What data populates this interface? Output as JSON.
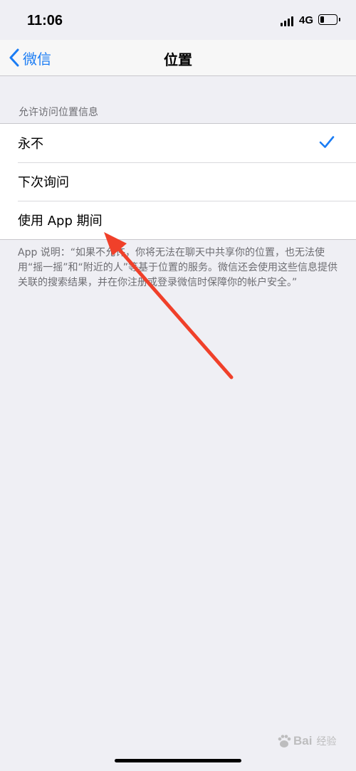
{
  "status_bar": {
    "time": "11:06",
    "network": "4G",
    "battery_level": 0.25
  },
  "nav": {
    "back_label": "微信",
    "title": "位置"
  },
  "section_header": "允许访问位置信息",
  "options": [
    {
      "label": "永不",
      "selected": true
    },
    {
      "label": "下次询问",
      "selected": false
    },
    {
      "label": "使用 App 期间",
      "selected": false
    }
  ],
  "footer_text": "App 说明：“如果不允许，你将无法在聊天中共享你的位置，也无法使用“摇一摇”和“附近的人”等基于位置的服务。微信还会使用这些信息提供关联的搜索结果，并在你注册或登录微信时保障你的帐户安全。”",
  "watermark": {
    "text": "Bai",
    "subtext": "经验"
  },
  "colors": {
    "accent": "#1a7cf4",
    "arrow": "#f0402a",
    "background": "#efeff4"
  }
}
